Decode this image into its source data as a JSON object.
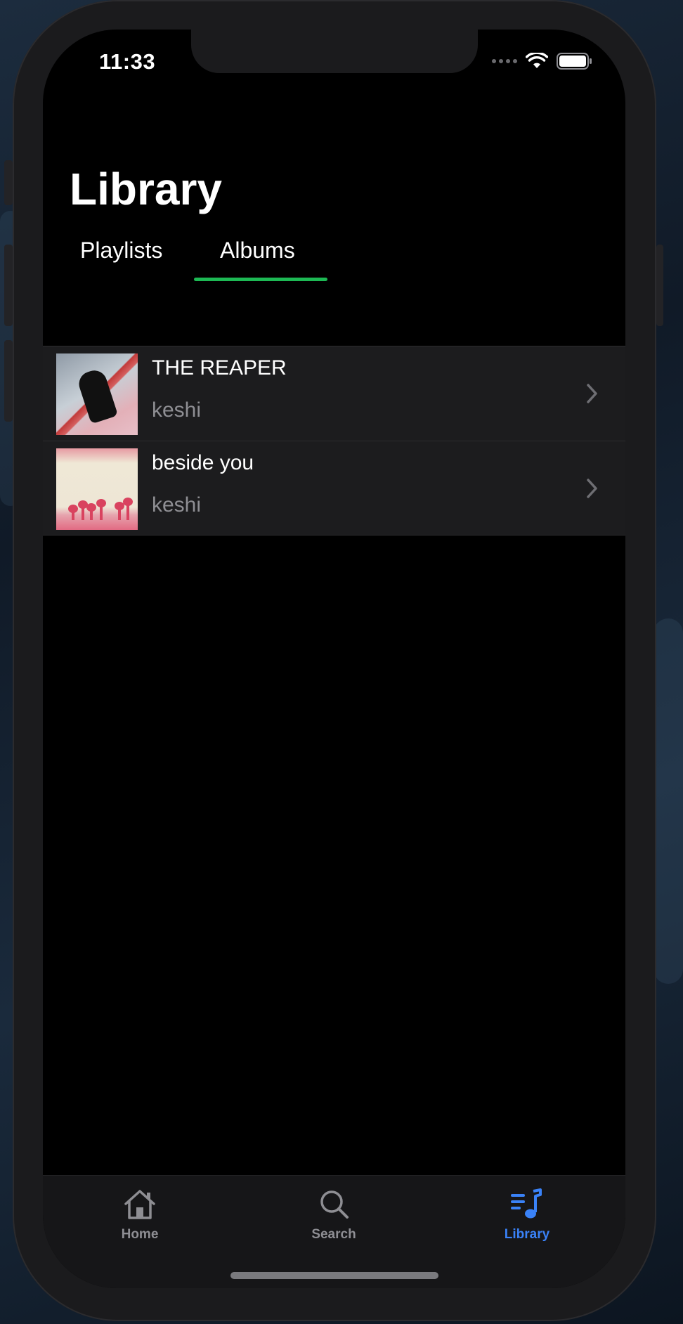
{
  "status_bar": {
    "time": "11:33"
  },
  "header": {
    "title": "Library"
  },
  "tabs": [
    {
      "label": "Playlists",
      "selected": false
    },
    {
      "label": "Albums",
      "selected": true
    }
  ],
  "albums": [
    {
      "title": "THE REAPER",
      "artist": "keshi"
    },
    {
      "title": "beside you",
      "artist": "keshi"
    }
  ],
  "tab_bar": {
    "items": [
      {
        "label": "Home",
        "icon": "house-icon"
      },
      {
        "label": "Search",
        "icon": "magnifier-icon"
      },
      {
        "label": "Library",
        "icon": "music-library-icon",
        "active": true
      }
    ]
  },
  "colors": {
    "accent_underline": "#1db954",
    "active_tab": "#3a82f7",
    "inactive_tab": "#8e8e93",
    "row_background": "#1c1c1e"
  }
}
